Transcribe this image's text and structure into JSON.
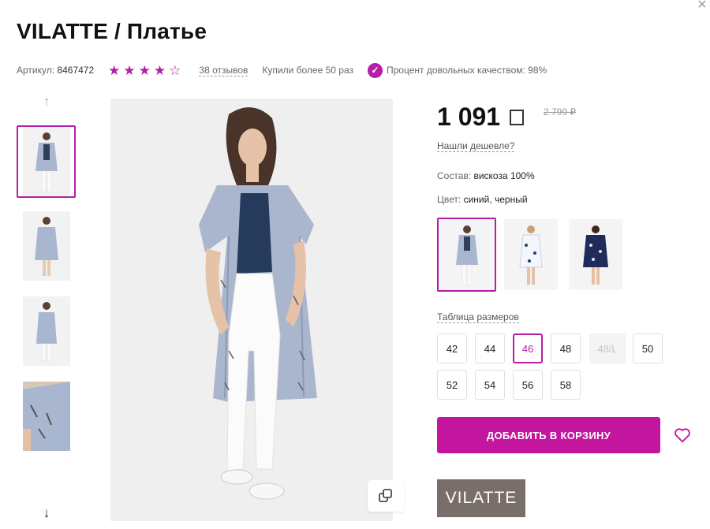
{
  "header": {
    "title": "VILATTE / Платье",
    "close_icon": "close-icon"
  },
  "meta": {
    "article_label": "Артикул:",
    "article_value": "8467472",
    "rating": 4,
    "rating_max": 5,
    "reviews": "38 отзывов",
    "bought": "Купили более 50 раз",
    "quality": "Процент довольных качеством: 98%"
  },
  "gallery": {
    "thumbnails": [
      "thumb-1",
      "thumb-2",
      "thumb-3",
      "thumb-4"
    ],
    "active_index": 0
  },
  "price": {
    "current": "1 091",
    "old": "2 799 ₽",
    "cheaper_link": "Нашли дешевле?"
  },
  "details": {
    "composition_label": "Состав:",
    "composition_value": "вискоза 100%",
    "color_label": "Цвет:",
    "color_value": "синий, черный"
  },
  "colors": {
    "options": [
      "blue-striped",
      "white-floral",
      "navy-floral"
    ],
    "active_index": 0
  },
  "sizes": {
    "table_link": "Таблица размеров",
    "row1": [
      "42",
      "44",
      "46",
      "48",
      "48/L",
      "50"
    ],
    "row2": [
      "52",
      "54",
      "56",
      "58"
    ],
    "active": "46",
    "disabled": "48/L"
  },
  "actions": {
    "add_to_cart": "ДОБАВИТЬ В КОРЗИНУ"
  },
  "brand": {
    "logo_text": "VILATTE"
  },
  "colors_theme": {
    "accent": "#c4159f",
    "brand_bg": "#7a6e6b"
  }
}
